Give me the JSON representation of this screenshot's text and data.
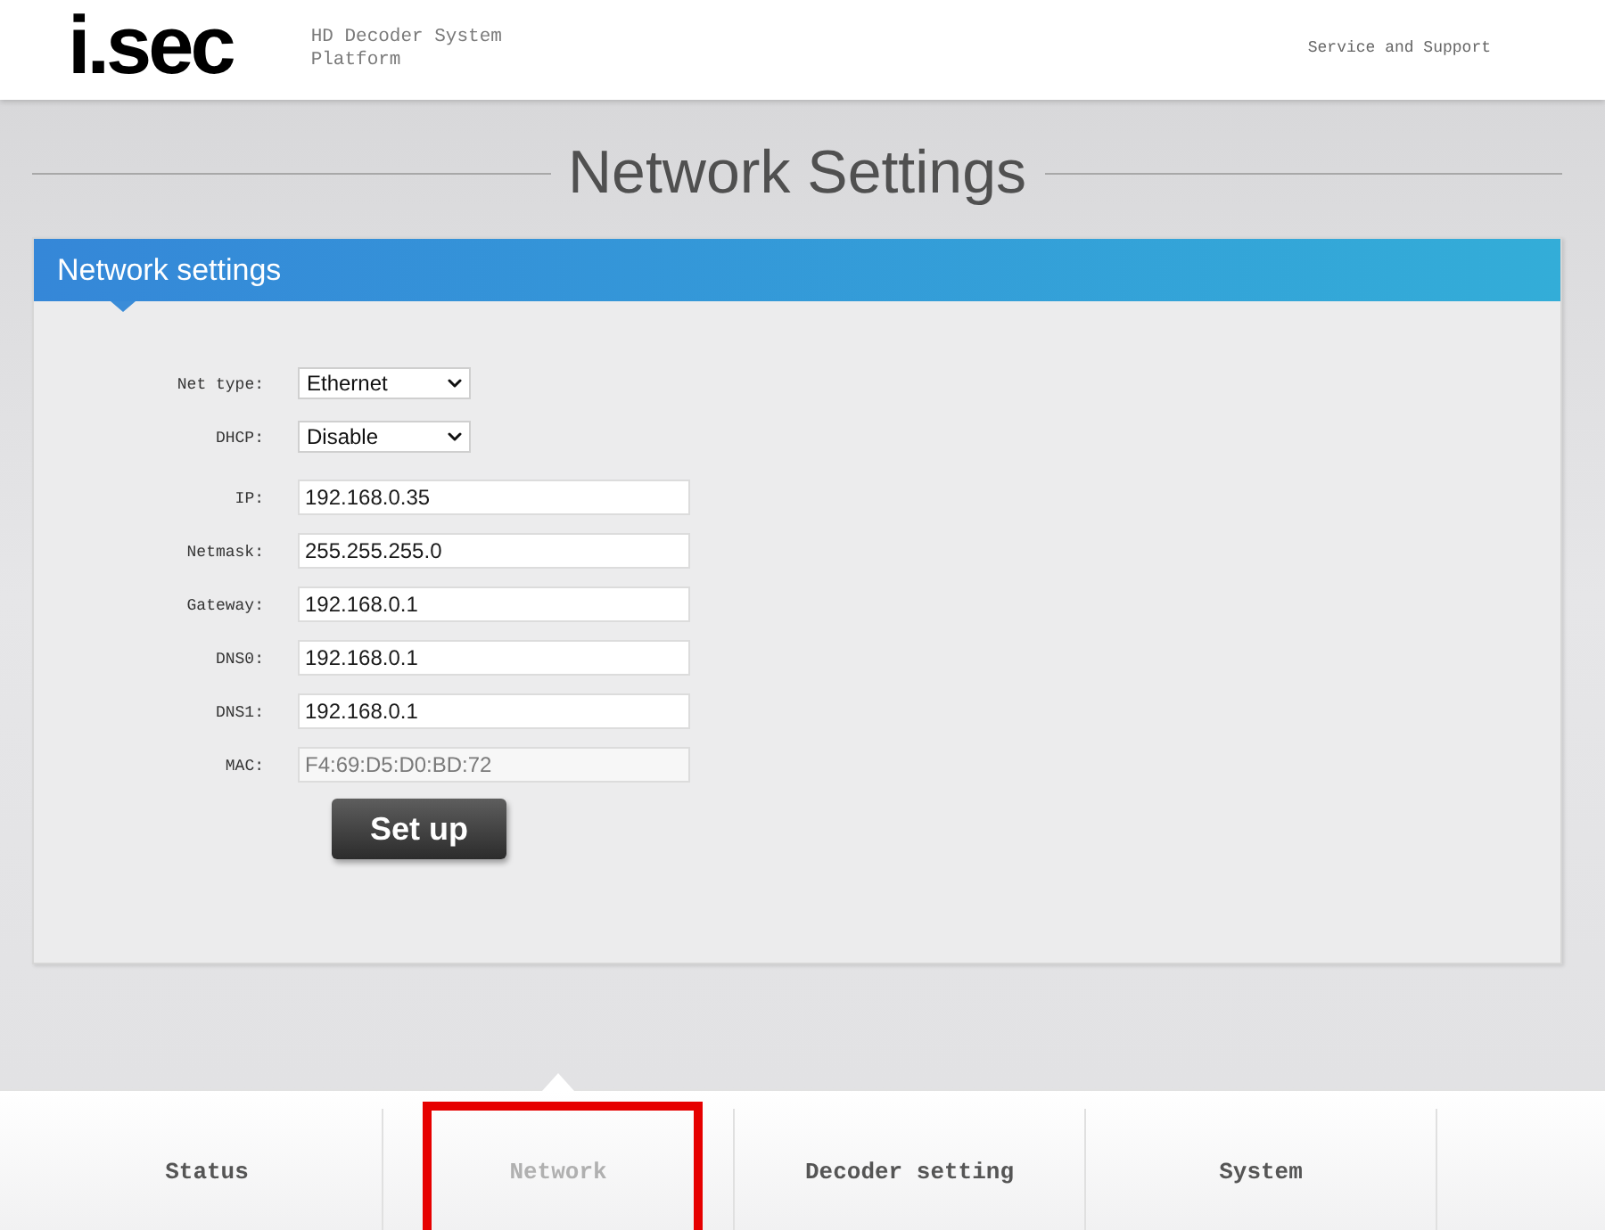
{
  "header": {
    "logo": "i.sec",
    "subtitle": "HD Decoder System Platform",
    "link": "Service and Support"
  },
  "page_title": "Network Settings",
  "panel": {
    "title": "Network settings",
    "fields": [
      {
        "kind": "select",
        "label": "Net type:",
        "value": "Ethernet",
        "disabled": false
      },
      {
        "kind": "select",
        "label": "DHCP:",
        "value": "Disable",
        "disabled": false
      },
      {
        "kind": "text",
        "label": "IP:",
        "value": "192.168.0.35",
        "disabled": false
      },
      {
        "kind": "text",
        "label": "Netmask:",
        "value": "255.255.255.0",
        "disabled": false
      },
      {
        "kind": "text",
        "label": "Gateway:",
        "value": "192.168.0.1",
        "disabled": false
      },
      {
        "kind": "text",
        "label": "DNS0:",
        "value": "192.168.0.1",
        "disabled": false
      },
      {
        "kind": "text",
        "label": "DNS1:",
        "value": "192.168.0.1",
        "disabled": false
      },
      {
        "kind": "text",
        "label": "MAC:",
        "value": "F4:69:D5:D0:BD:72",
        "disabled": true
      }
    ],
    "button": "Set up"
  },
  "nav": {
    "tabs": [
      {
        "label": "Status",
        "selected": false,
        "highlighted": false
      },
      {
        "label": "Network",
        "selected": true,
        "highlighted": true
      },
      {
        "label": "Decoder setting",
        "selected": false,
        "highlighted": false
      },
      {
        "label": "System",
        "selected": false,
        "highlighted": false
      }
    ]
  }
}
